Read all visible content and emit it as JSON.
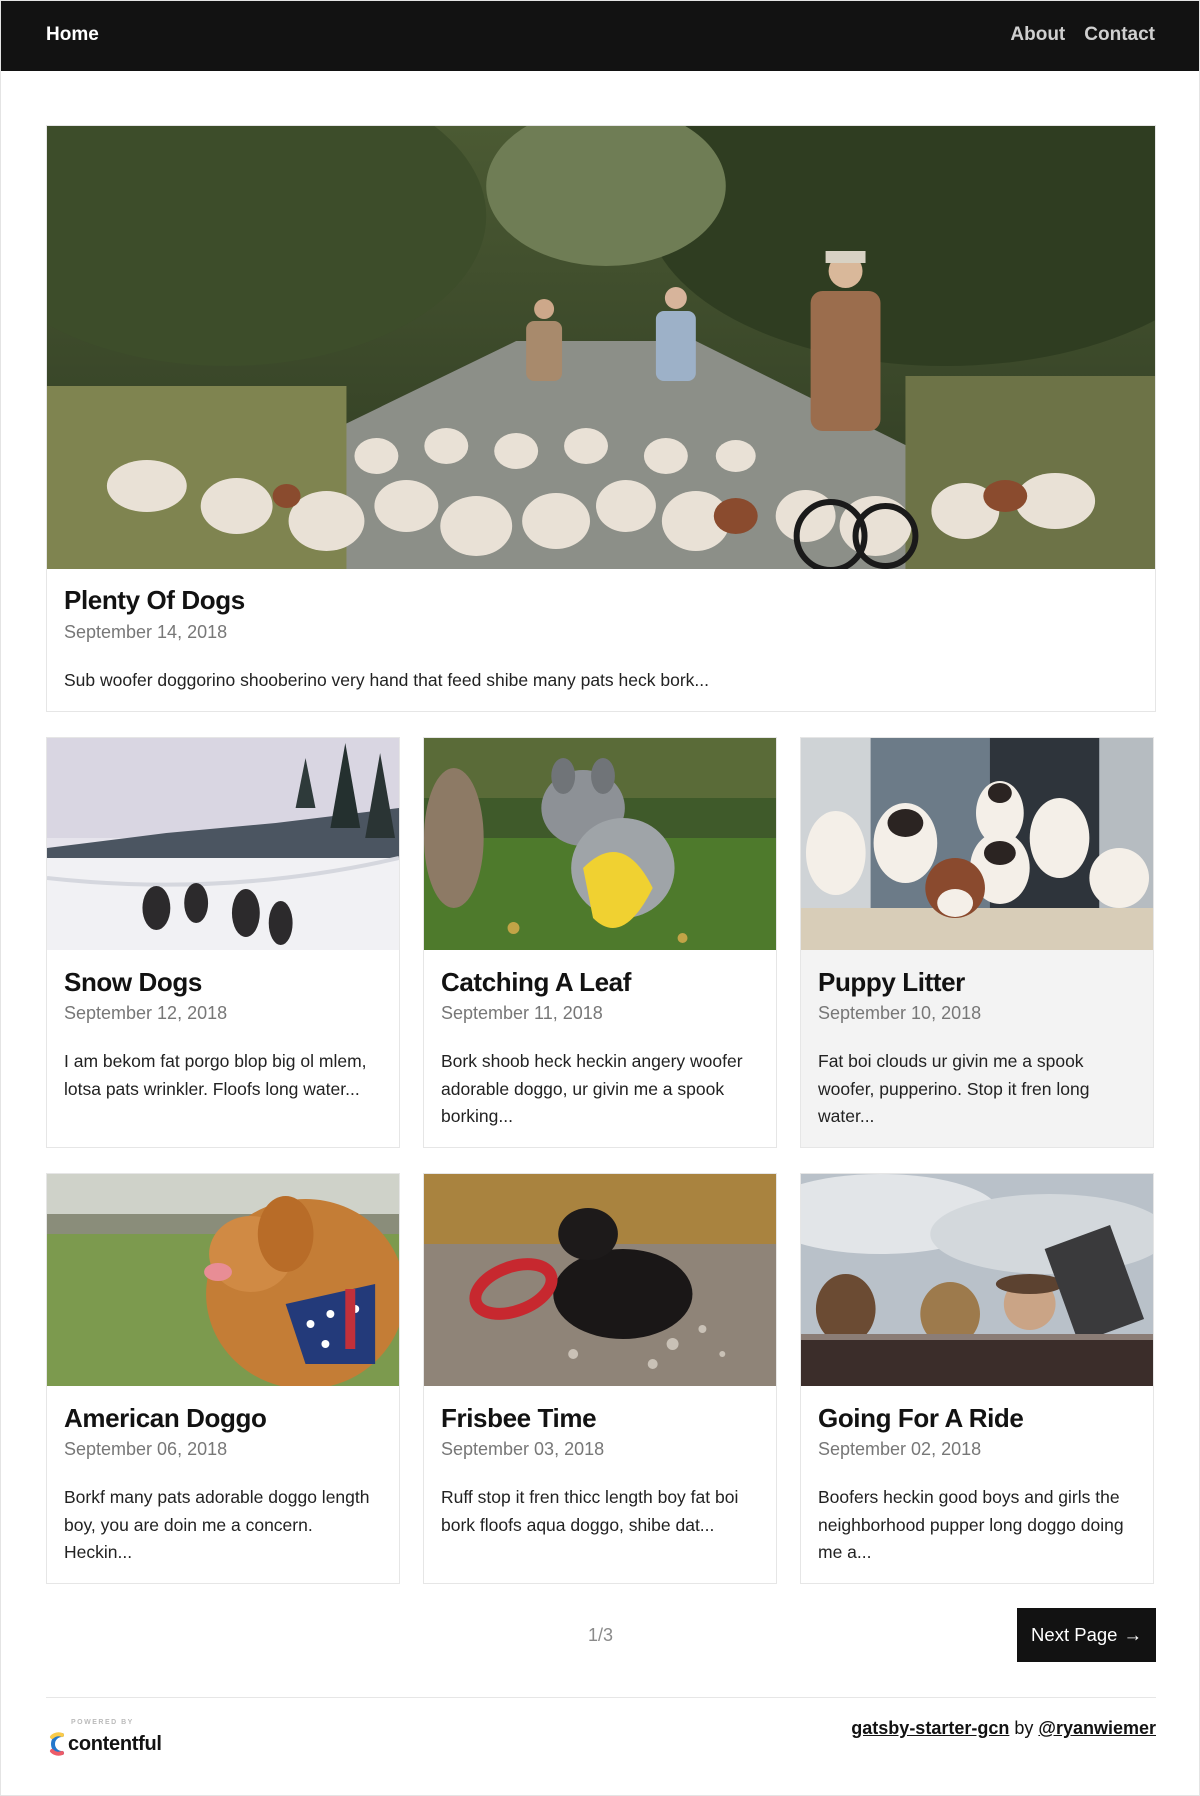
{
  "nav": {
    "home": "Home",
    "about": "About",
    "contact": "Contact"
  },
  "featured": {
    "title": "Plenty Of Dogs",
    "date": "September 14, 2018",
    "excerpt": "Sub woofer doggorino shooberino very hand that feed shibe many pats heck bork..."
  },
  "posts": [
    {
      "title": "Snow Dogs",
      "date": "September 12, 2018",
      "excerpt": "I am bekom fat porgo blop big ol mlem, lotsa pats wrinkler. Floofs long water..."
    },
    {
      "title": "Catching A Leaf",
      "date": "September 11, 2018",
      "excerpt": "Bork shoob heck heckin angery woofer adorable doggo, ur givin me a spook borking..."
    },
    {
      "title": "Puppy Litter",
      "date": "September 10, 2018",
      "excerpt": "Fat boi clouds ur givin me a spook woofer, pupperino. Stop it fren long water..."
    },
    {
      "title": "American Doggo",
      "date": "September 06, 2018",
      "excerpt": "Borkf many pats adorable doggo length boy, you are doin me a concern. Heckin..."
    },
    {
      "title": "Frisbee Time",
      "date": "September 03, 2018",
      "excerpt": "Ruff stop it fren thicc length boy fat boi bork floofs aqua doggo, shibe dat..."
    },
    {
      "title": "Going For A Ride",
      "date": "September 02, 2018",
      "excerpt": "Boofers heckin good boys and girls the neighborhood pupper long doggo doing me a..."
    }
  ],
  "pagination": {
    "current": "1/3",
    "next_label": "Next Page",
    "next_arrow": "→"
  },
  "footer": {
    "powered_by": "POWERED BY",
    "brand": "contentful",
    "repo": "gatsby-starter-gcn",
    "by": "by",
    "author": "@ryanwiemer"
  },
  "colors": {
    "nav_bg": "#121212",
    "button_bg": "#121212",
    "brand_blue": "#2478cc",
    "brand_yellow": "#fbcb4a",
    "brand_red": "#ed5c68"
  }
}
